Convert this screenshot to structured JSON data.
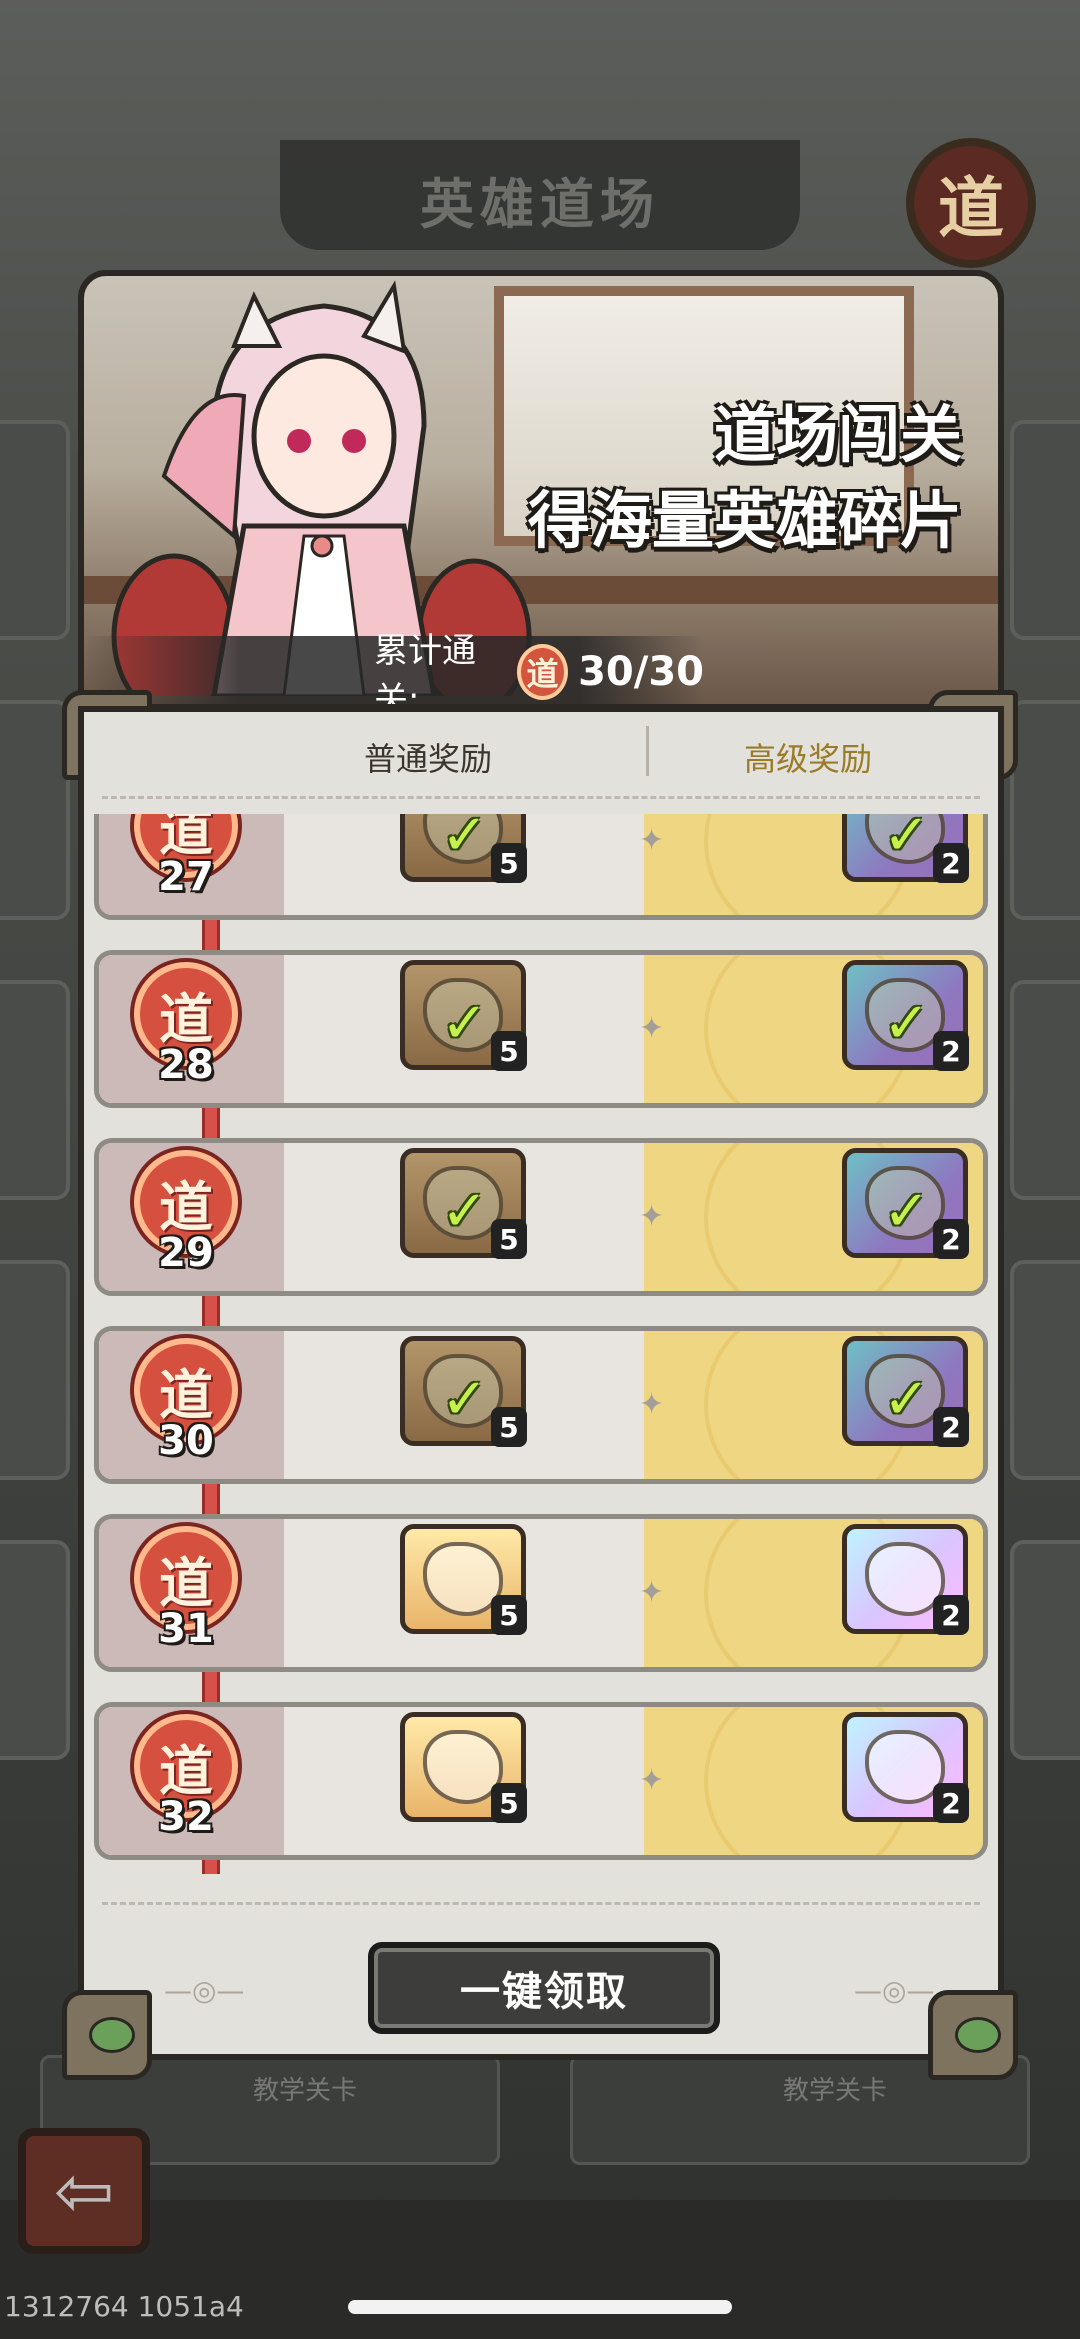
{
  "background": {
    "title": "英雄道场",
    "badge": "道",
    "tab_left": "教学关卡",
    "tab_right": "教学关卡"
  },
  "banner": {
    "headline": "道场闯关",
    "subline": "得海量英雄碎片",
    "progress_label": "累计通关:",
    "progress_icon": "道",
    "progress_value": "30/30"
  },
  "columns": {
    "normal": "普通奖励",
    "premium": "高级奖励"
  },
  "rows": [
    {
      "badge": "道",
      "level": "27",
      "normal_count": "5",
      "premium_count": "2",
      "claimed": true
    },
    {
      "badge": "道",
      "level": "28",
      "normal_count": "5",
      "premium_count": "2",
      "claimed": true
    },
    {
      "badge": "道",
      "level": "29",
      "normal_count": "5",
      "premium_count": "2",
      "claimed": true
    },
    {
      "badge": "道",
      "level": "30",
      "normal_count": "5",
      "premium_count": "2",
      "claimed": true
    },
    {
      "badge": "道",
      "level": "31",
      "normal_count": "5",
      "premium_count": "2",
      "claimed": false
    },
    {
      "badge": "道",
      "level": "32",
      "normal_count": "5",
      "premium_count": "2",
      "claimed": false
    }
  ],
  "claim_all_label": "一键领取",
  "check_glyph": "✓",
  "back_glyph": "⇦",
  "watermark": "1312764 1051a4",
  "colors": {
    "accent_red": "#d5503f",
    "premium_gold": "#efd683",
    "check_green": "#c8f04a"
  }
}
